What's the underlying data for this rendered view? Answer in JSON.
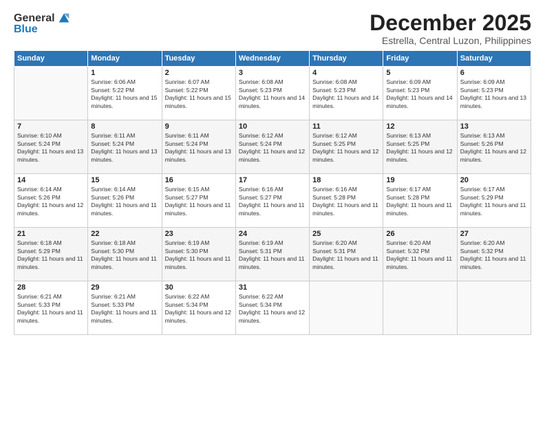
{
  "header": {
    "logo_general": "General",
    "logo_blue": "Blue",
    "month": "December 2025",
    "location": "Estrella, Central Luzon, Philippines"
  },
  "weekdays": [
    "Sunday",
    "Monday",
    "Tuesday",
    "Wednesday",
    "Thursday",
    "Friday",
    "Saturday"
  ],
  "weeks": [
    [
      {
        "day": "",
        "sunrise": "",
        "sunset": "",
        "daylight": ""
      },
      {
        "day": "1",
        "sunrise": "Sunrise: 6:06 AM",
        "sunset": "Sunset: 5:22 PM",
        "daylight": "Daylight: 11 hours and 15 minutes."
      },
      {
        "day": "2",
        "sunrise": "Sunrise: 6:07 AM",
        "sunset": "Sunset: 5:22 PM",
        "daylight": "Daylight: 11 hours and 15 minutes."
      },
      {
        "day": "3",
        "sunrise": "Sunrise: 6:08 AM",
        "sunset": "Sunset: 5:23 PM",
        "daylight": "Daylight: 11 hours and 14 minutes."
      },
      {
        "day": "4",
        "sunrise": "Sunrise: 6:08 AM",
        "sunset": "Sunset: 5:23 PM",
        "daylight": "Daylight: 11 hours and 14 minutes."
      },
      {
        "day": "5",
        "sunrise": "Sunrise: 6:09 AM",
        "sunset": "Sunset: 5:23 PM",
        "daylight": "Daylight: 11 hours and 14 minutes."
      },
      {
        "day": "6",
        "sunrise": "Sunrise: 6:09 AM",
        "sunset": "Sunset: 5:23 PM",
        "daylight": "Daylight: 11 hours and 13 minutes."
      }
    ],
    [
      {
        "day": "7",
        "sunrise": "Sunrise: 6:10 AM",
        "sunset": "Sunset: 5:24 PM",
        "daylight": "Daylight: 11 hours and 13 minutes."
      },
      {
        "day": "8",
        "sunrise": "Sunrise: 6:11 AM",
        "sunset": "Sunset: 5:24 PM",
        "daylight": "Daylight: 11 hours and 13 minutes."
      },
      {
        "day": "9",
        "sunrise": "Sunrise: 6:11 AM",
        "sunset": "Sunset: 5:24 PM",
        "daylight": "Daylight: 11 hours and 13 minutes."
      },
      {
        "day": "10",
        "sunrise": "Sunrise: 6:12 AM",
        "sunset": "Sunset: 5:24 PM",
        "daylight": "Daylight: 11 hours and 12 minutes."
      },
      {
        "day": "11",
        "sunrise": "Sunrise: 6:12 AM",
        "sunset": "Sunset: 5:25 PM",
        "daylight": "Daylight: 11 hours and 12 minutes."
      },
      {
        "day": "12",
        "sunrise": "Sunrise: 6:13 AM",
        "sunset": "Sunset: 5:25 PM",
        "daylight": "Daylight: 11 hours and 12 minutes."
      },
      {
        "day": "13",
        "sunrise": "Sunrise: 6:13 AM",
        "sunset": "Sunset: 5:26 PM",
        "daylight": "Daylight: 11 hours and 12 minutes."
      }
    ],
    [
      {
        "day": "14",
        "sunrise": "Sunrise: 6:14 AM",
        "sunset": "Sunset: 5:26 PM",
        "daylight": "Daylight: 11 hours and 12 minutes."
      },
      {
        "day": "15",
        "sunrise": "Sunrise: 6:14 AM",
        "sunset": "Sunset: 5:26 PM",
        "daylight": "Daylight: 11 hours and 11 minutes."
      },
      {
        "day": "16",
        "sunrise": "Sunrise: 6:15 AM",
        "sunset": "Sunset: 5:27 PM",
        "daylight": "Daylight: 11 hours and 11 minutes."
      },
      {
        "day": "17",
        "sunrise": "Sunrise: 6:16 AM",
        "sunset": "Sunset: 5:27 PM",
        "daylight": "Daylight: 11 hours and 11 minutes."
      },
      {
        "day": "18",
        "sunrise": "Sunrise: 6:16 AM",
        "sunset": "Sunset: 5:28 PM",
        "daylight": "Daylight: 11 hours and 11 minutes."
      },
      {
        "day": "19",
        "sunrise": "Sunrise: 6:17 AM",
        "sunset": "Sunset: 5:28 PM",
        "daylight": "Daylight: 11 hours and 11 minutes."
      },
      {
        "day": "20",
        "sunrise": "Sunrise: 6:17 AM",
        "sunset": "Sunset: 5:29 PM",
        "daylight": "Daylight: 11 hours and 11 minutes."
      }
    ],
    [
      {
        "day": "21",
        "sunrise": "Sunrise: 6:18 AM",
        "sunset": "Sunset: 5:29 PM",
        "daylight": "Daylight: 11 hours and 11 minutes."
      },
      {
        "day": "22",
        "sunrise": "Sunrise: 6:18 AM",
        "sunset": "Sunset: 5:30 PM",
        "daylight": "Daylight: 11 hours and 11 minutes."
      },
      {
        "day": "23",
        "sunrise": "Sunrise: 6:19 AM",
        "sunset": "Sunset: 5:30 PM",
        "daylight": "Daylight: 11 hours and 11 minutes."
      },
      {
        "day": "24",
        "sunrise": "Sunrise: 6:19 AM",
        "sunset": "Sunset: 5:31 PM",
        "daylight": "Daylight: 11 hours and 11 minutes."
      },
      {
        "day": "25",
        "sunrise": "Sunrise: 6:20 AM",
        "sunset": "Sunset: 5:31 PM",
        "daylight": "Daylight: 11 hours and 11 minutes."
      },
      {
        "day": "26",
        "sunrise": "Sunrise: 6:20 AM",
        "sunset": "Sunset: 5:32 PM",
        "daylight": "Daylight: 11 hours and 11 minutes."
      },
      {
        "day": "27",
        "sunrise": "Sunrise: 6:20 AM",
        "sunset": "Sunset: 5:32 PM",
        "daylight": "Daylight: 11 hours and 11 minutes."
      }
    ],
    [
      {
        "day": "28",
        "sunrise": "Sunrise: 6:21 AM",
        "sunset": "Sunset: 5:33 PM",
        "daylight": "Daylight: 11 hours and 11 minutes."
      },
      {
        "day": "29",
        "sunrise": "Sunrise: 6:21 AM",
        "sunset": "Sunset: 5:33 PM",
        "daylight": "Daylight: 11 hours and 11 minutes."
      },
      {
        "day": "30",
        "sunrise": "Sunrise: 6:22 AM",
        "sunset": "Sunset: 5:34 PM",
        "daylight": "Daylight: 11 hours and 12 minutes."
      },
      {
        "day": "31",
        "sunrise": "Sunrise: 6:22 AM",
        "sunset": "Sunset: 5:34 PM",
        "daylight": "Daylight: 11 hours and 12 minutes."
      },
      {
        "day": "",
        "sunrise": "",
        "sunset": "",
        "daylight": ""
      },
      {
        "day": "",
        "sunrise": "",
        "sunset": "",
        "daylight": ""
      },
      {
        "day": "",
        "sunrise": "",
        "sunset": "",
        "daylight": ""
      }
    ]
  ]
}
